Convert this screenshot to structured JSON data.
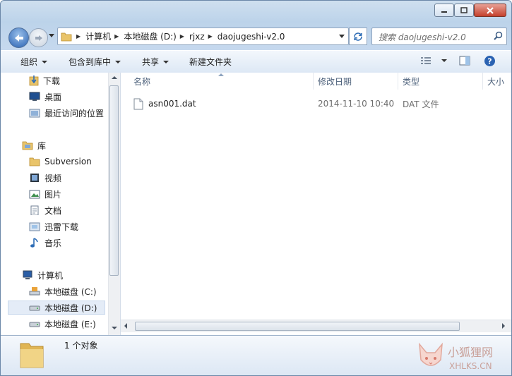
{
  "window": {
    "controls": {
      "minimize": "minimize-icon",
      "maximize": "maximize-icon",
      "close": "close-icon"
    }
  },
  "address": {
    "segments": [
      "计算机",
      "本地磁盘 (D:)",
      "rjxz",
      "daojugeshi-v2.0"
    ]
  },
  "search": {
    "placeholder": "搜索 daojugeshi-v2.0"
  },
  "toolbar": {
    "organize": "组织",
    "include_library": "包含到库中",
    "share": "共享",
    "new_folder": "新建文件夹"
  },
  "nav": {
    "favorites": [
      "下载",
      "桌面",
      "最近访问的位置"
    ],
    "library_title": "库",
    "libraries": [
      "Subversion",
      "视频",
      "图片",
      "文档",
      "迅雷下载",
      "音乐"
    ],
    "computer_title": "计算机",
    "drives": [
      "本地磁盘 (C:)",
      "本地磁盘 (D:)",
      "本地磁盘 (E:)"
    ]
  },
  "columns": {
    "name": "名称",
    "date": "修改日期",
    "type": "类型",
    "size": "大小"
  },
  "files": [
    {
      "name": "asn001.dat",
      "date": "2014-11-10 10:40",
      "type": "DAT 文件"
    }
  ],
  "status": {
    "count": "1 个对象"
  },
  "watermark": {
    "name": "小狐狸网",
    "url": "XHLKS.CN"
  },
  "colors": {
    "accent": "#3a6ea8",
    "selected_bg": "#e4ecf7",
    "folder": "#e9c46a"
  }
}
